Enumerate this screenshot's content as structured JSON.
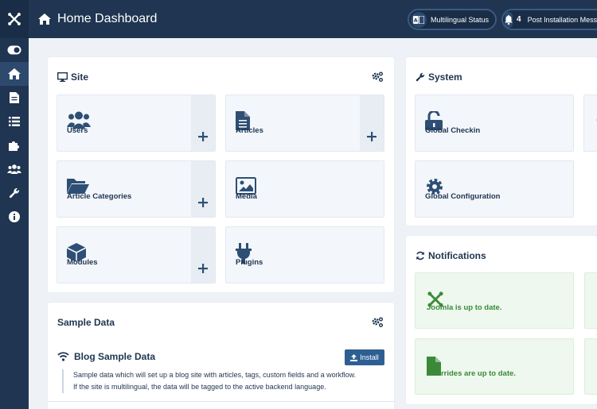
{
  "header": {
    "title": "Home Dashboard",
    "multilingual_label": "Multilingual Status",
    "post_install_count": "4",
    "post_install_label": "Post Installation Messages"
  },
  "sidebar": {
    "items": [
      "toggle-menu",
      "home",
      "content",
      "menus",
      "components",
      "users",
      "system",
      "help"
    ]
  },
  "site": {
    "title": "Site",
    "tiles": [
      {
        "label": "Users",
        "icon": "users-icon",
        "add": true
      },
      {
        "label": "Articles",
        "icon": "file-icon",
        "add": true
      },
      {
        "label": "Article Categories",
        "icon": "folder-open-icon",
        "add": true
      },
      {
        "label": "Media",
        "icon": "image-icon",
        "add": false
      },
      {
        "label": "Modules",
        "icon": "cube-icon",
        "add": true
      },
      {
        "label": "Plugins",
        "icon": "plug-icon",
        "add": false
      }
    ]
  },
  "system": {
    "title": "System",
    "tiles": [
      {
        "label": "Global Checkin",
        "icon": "unlock-icon"
      },
      {
        "label": "Global Configuration",
        "icon": "cog-icon"
      }
    ]
  },
  "notifications": {
    "title": "Notifications",
    "items": [
      {
        "label": "Joomla is up to date.",
        "icon": "joomla-icon"
      },
      {
        "label": "Overrides are up to date.",
        "icon": "file-icon"
      }
    ]
  },
  "sample_data": {
    "title": "Sample Data",
    "item_title": "Blog Sample Data",
    "install_label": "Install",
    "description_line1": "Sample data which will set up a blog site with articles, tags, custom fields and a workflow.",
    "description_line2": "If the site is multilingual, the data will be tagged to the active backend language."
  },
  "colors": {
    "primary": "#1f3551",
    "accent": "#2e5f93",
    "success": "#3a8a3a",
    "background": "#eef2f7"
  }
}
